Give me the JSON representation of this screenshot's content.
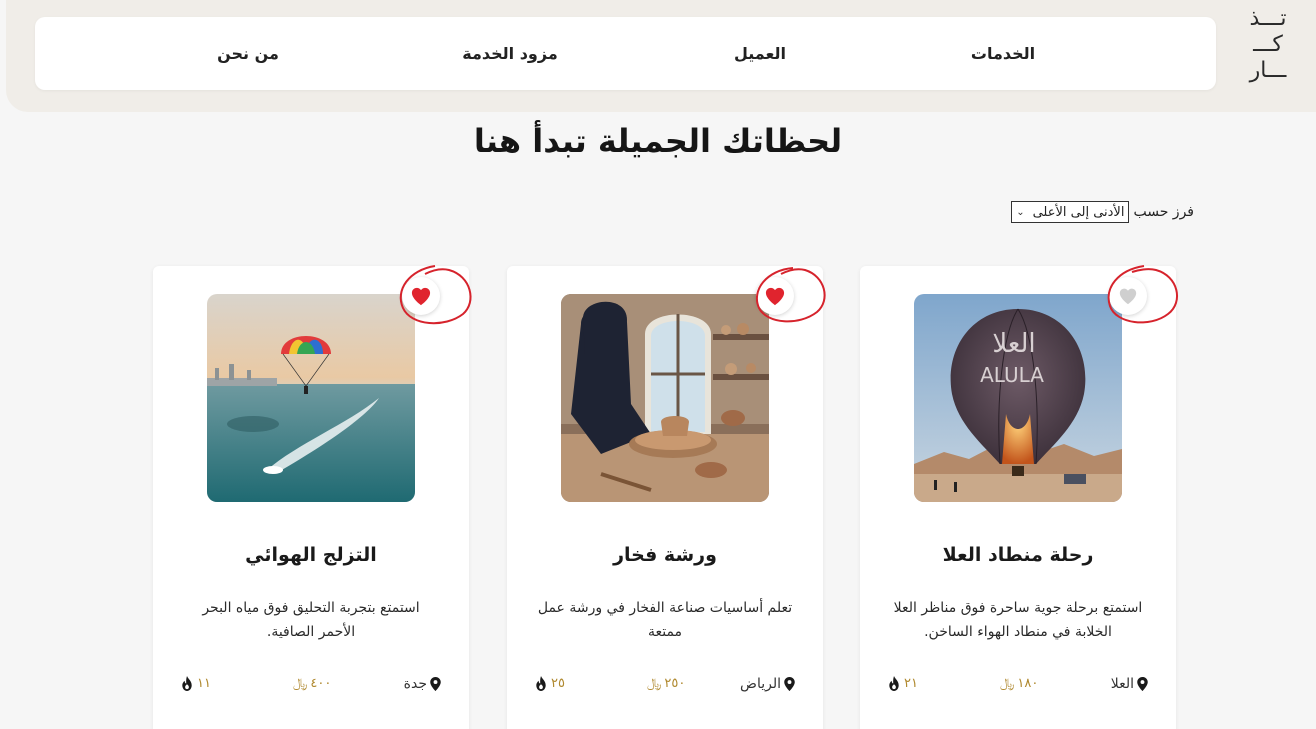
{
  "brand": {
    "logo_lines": [
      "تـــذ",
      "كـــ",
      "ـــار"
    ]
  },
  "nav": {
    "items": [
      {
        "label": "الخدمات"
      },
      {
        "label": "العميل"
      },
      {
        "label": "مزود الخدمة"
      },
      {
        "label": "من نحن"
      }
    ]
  },
  "headline": "لحظاتك الجميلة تبدأ هنا",
  "sort": {
    "label": "فرز حسب",
    "selected": "الأدنى إلى الأعلى"
  },
  "colors": {
    "accent_red": "#e0242e",
    "gold": "#b0892f",
    "annotation": "#d6232c"
  },
  "cards": [
    {
      "title": "رحلة منطاد العلا",
      "description": "استمتع برحلة جوية ساحرة فوق مناظر العلا الخلابة في منطاد الهواء الساخن.",
      "location": "العلا",
      "price": "١٨٠",
      "count": "٢١",
      "favorited": false,
      "image_icon": "hot-air-balloon-image",
      "balloon_text_ar": "العلا",
      "balloon_text_en": "ALULA"
    },
    {
      "title": "ورشة فخار",
      "description": "تعلم أساسيات صناعة الفخار في ورشة عمل ممتعة",
      "location": "الرياض",
      "price": "٢٥٠",
      "count": "٢٥",
      "favorited": true,
      "image_icon": "pottery-workshop-image"
    },
    {
      "title": "التزلج الهوائي",
      "description": "استمتع بتجربة التحليق فوق مياه البحر الأحمر الصافية.",
      "location": "جدة",
      "price": "٤٠٠",
      "count": "١١",
      "favorited": true,
      "image_icon": "parasailing-image"
    }
  ]
}
